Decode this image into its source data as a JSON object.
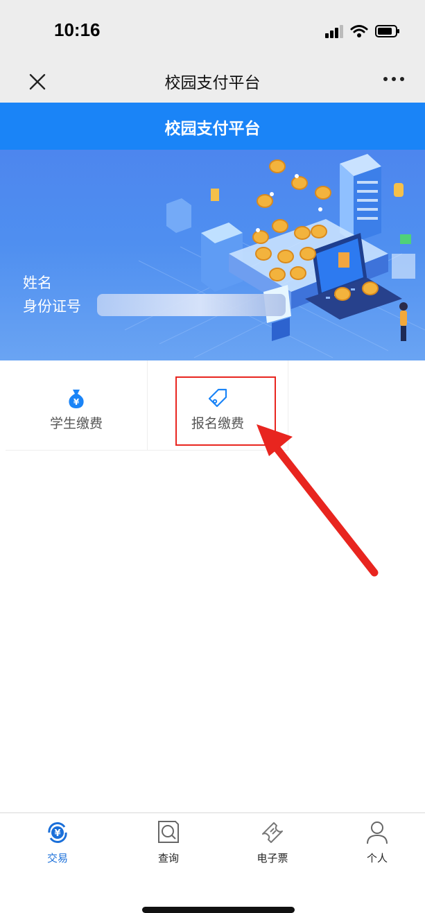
{
  "status_bar": {
    "time": "10:16"
  },
  "nav": {
    "title": "校园支付平台"
  },
  "header": {
    "title": "校园支付平台"
  },
  "banner": {
    "name_label": "姓名",
    "id_label": "身份证号"
  },
  "services": [
    {
      "label": "学生缴费",
      "icon": "money-bag-icon"
    },
    {
      "label": "报名缴费",
      "icon": "tag-icon"
    }
  ],
  "tabs": [
    {
      "label": "交易",
      "icon": "yuan-exchange-icon",
      "active": true
    },
    {
      "label": "查询",
      "icon": "search-icon",
      "active": false
    },
    {
      "label": "电子票",
      "icon": "ticket-icon",
      "active": false
    },
    {
      "label": "个人",
      "icon": "user-icon",
      "active": false
    }
  ],
  "colors": {
    "primary": "#1a84f7",
    "active_tab": "#1a6fd9",
    "annotation": "#e8251f",
    "nav_bg": "#ededed"
  }
}
